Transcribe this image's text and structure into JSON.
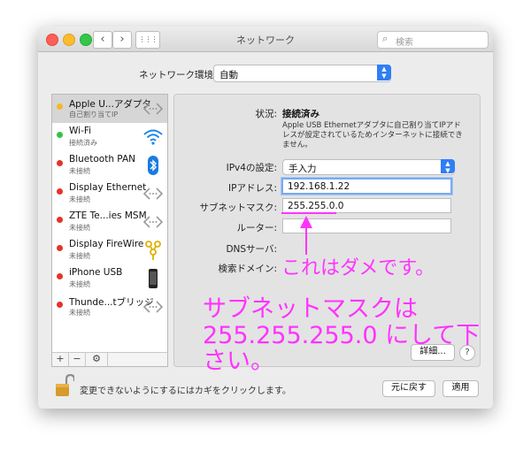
{
  "window": {
    "title": "ネットワーク",
    "search_placeholder": "検索",
    "nav_back": "‹",
    "nav_forward": "›",
    "grid_icon": "⋮⋮⋮"
  },
  "location": {
    "label": "ネットワーク環境:",
    "value": "自動"
  },
  "services": [
    {
      "name": "Apple U...アダプタ",
      "status": "自己割り当てIP",
      "dot_color": "#f5b72a",
      "icon": "ethernet-icon"
    },
    {
      "name": "Wi-Fi",
      "status": "接続済み",
      "dot_color": "#38c149",
      "icon": "wifi-icon"
    },
    {
      "name": "Bluetooth PAN",
      "status": "未接続",
      "dot_color": "#e5332a",
      "icon": "bluetooth-icon"
    },
    {
      "name": "Display Ethernet",
      "status": "未接続",
      "dot_color": "#e5332a",
      "icon": "ethernet-icon"
    },
    {
      "name": "ZTE Te...ies MSM",
      "status": "未接続",
      "dot_color": "#e5332a",
      "icon": "ethernet-icon"
    },
    {
      "name": "Display FireWire",
      "status": "未接続",
      "dot_color": "#e5332a",
      "icon": "firewire-icon"
    },
    {
      "name": "iPhone USB",
      "status": "未接続",
      "dot_color": "#e5332a",
      "icon": "iphone-icon"
    },
    {
      "name": "Thunde...tブリッジ",
      "status": "未接続",
      "dot_color": "#e5332a",
      "icon": "ethernet-icon"
    }
  ],
  "sidebar_tools": {
    "add": "+",
    "remove": "−",
    "gear": "⚙"
  },
  "detail": {
    "status_label": "状況:",
    "status_value": "接続済み",
    "status_description": "Apple USB Ethernetアダプタに自己割り当てIPアドレスが設定されているためインターネットに接続できません。",
    "ipv4_label": "IPv4の設定:",
    "ipv4_value": "手入力",
    "ip_label": "IPアドレス:",
    "ip_value": "192.168.1.22",
    "subnet_label": "サブネットマスク:",
    "subnet_value": "255.255.0.0",
    "router_label": "ルーター:",
    "router_value": "",
    "dns_label": "DNSサーバ:",
    "search_domain_label": "検索ドメイン:",
    "advanced_button": "詳細...",
    "help_button": "?"
  },
  "footer": {
    "lock_text": "変更できないようにするにはカギをクリックします。",
    "revert_button": "元に戻す",
    "apply_button": "適用"
  },
  "annotation": {
    "line1": "これはダメです。",
    "line2": "サブネットマスクは",
    "line3": "255.255.255.0 にして下",
    "line4": "さい。",
    "color": "#ff33ff"
  }
}
